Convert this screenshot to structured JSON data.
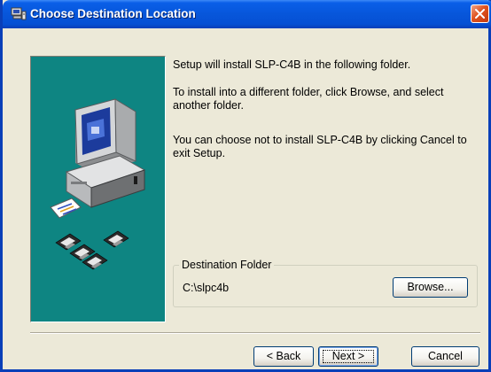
{
  "window": {
    "title": "Choose Destination Location"
  },
  "content": {
    "line1": "Setup will install SLP-C4B in the following folder.",
    "line2": "To install into a different folder, click Browse, and select another folder.",
    "line3": "You can choose not to install SLP-C4B by clicking Cancel to exit Setup."
  },
  "destination": {
    "legend": "Destination Folder",
    "path": "C:\\slpc4b",
    "browse_label": "Browse..."
  },
  "buttons": {
    "back_label": "< Back",
    "next_label": "Next >",
    "cancel_label": "Cancel"
  },
  "colors": {
    "title_bar": "#0756da",
    "side_panel": "#0e8582",
    "close_button": "#e0531f"
  },
  "icons": {
    "title": "setup-computer-icon",
    "close": "close-icon",
    "side_illustration": "computer-with-disks-illustration"
  }
}
